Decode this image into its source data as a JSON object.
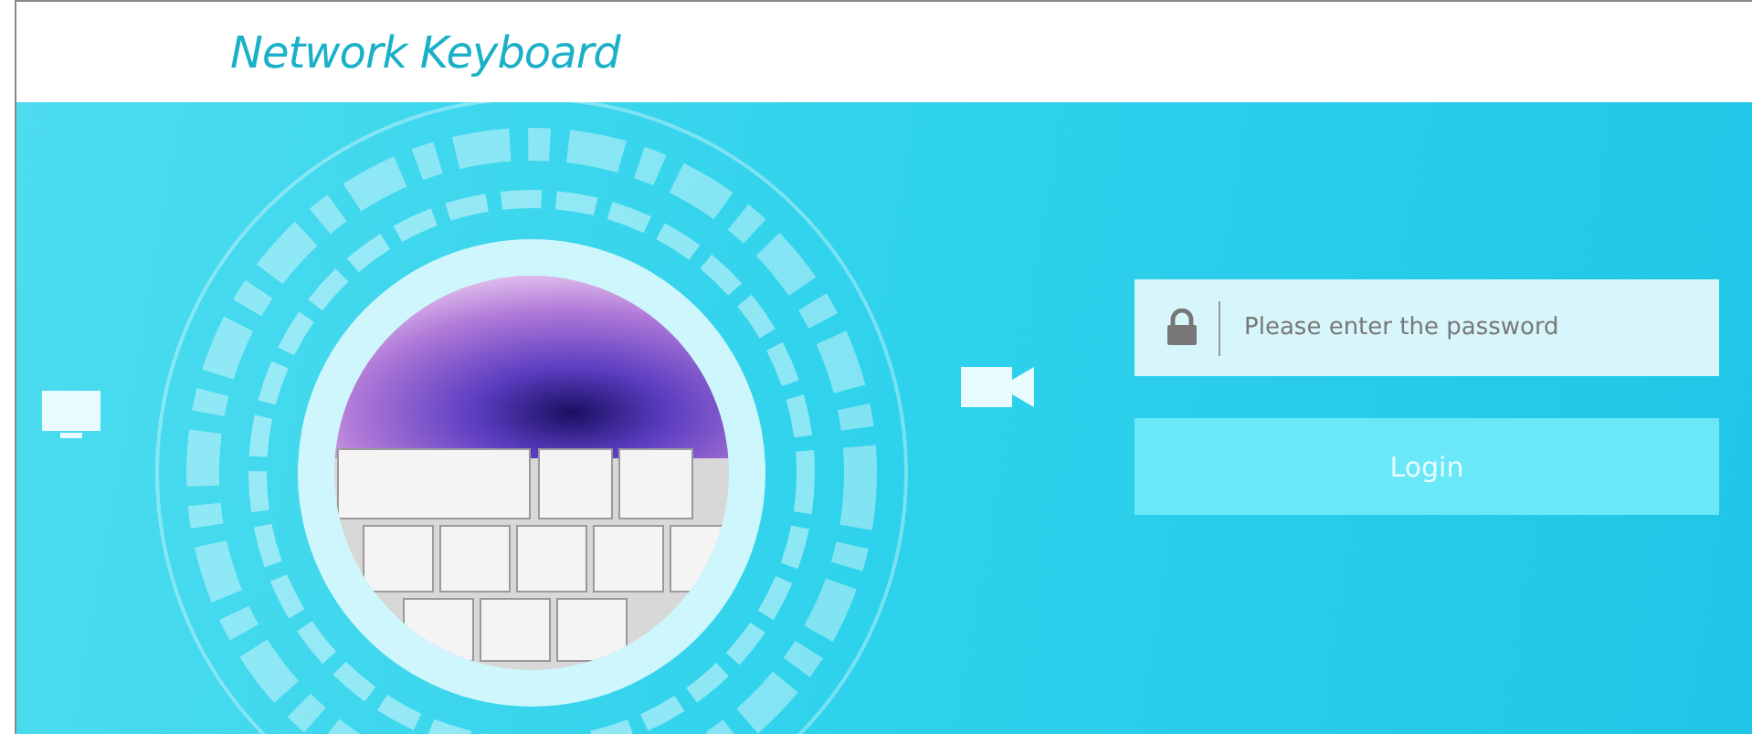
{
  "header": {
    "title": "Network Keyboard"
  },
  "password_field": {
    "placeholder": "Please enter the password"
  },
  "login_button": {
    "label": "Login"
  }
}
